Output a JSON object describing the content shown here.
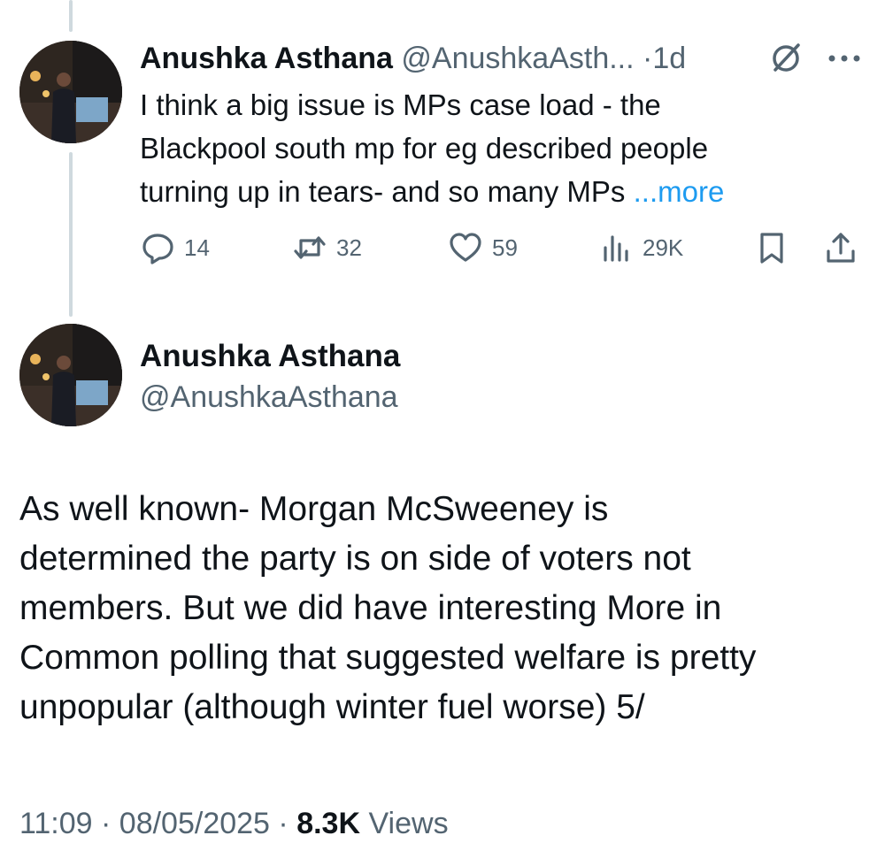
{
  "reply_tweet": {
    "author_name": "Anushka Asthana",
    "handle": "@AnushkaAsth...",
    "separator": "·",
    "time_ago": "1d",
    "text_lines": [
      "I think a big issue is MPs case load - the",
      "Blackpool south mp for eg described people",
      "turning up in tears- and so many MPs "
    ],
    "more_label": "...more",
    "actions": {
      "replies": "14",
      "retweets": "32",
      "likes": "59",
      "views": "29K"
    }
  },
  "main_tweet": {
    "author_name": "Anushka Asthana",
    "handle": "@AnushkaAsthana",
    "text_lines": [
      "As well known- Morgan McSweeney is",
      "determined the party is on side of voters not",
      "members. But we did have interesting More in",
      "Common polling that suggested welfare is pretty",
      "unpopular (although winter fuel worse) 5/"
    ],
    "time": "11:09",
    "date": "08/05/2025",
    "separator": "·",
    "views_count": "8.3K",
    "views_label": "Views"
  },
  "icons": [
    "reply-icon",
    "retweet-icon",
    "like-icon",
    "views-icon",
    "bookmark-icon",
    "share-icon",
    "grok-icon",
    "more-icon"
  ],
  "colors": {
    "text": "#0f1419",
    "secondary": "#536471",
    "link": "#1d9bf0",
    "thread_line": "#cfd9de"
  }
}
